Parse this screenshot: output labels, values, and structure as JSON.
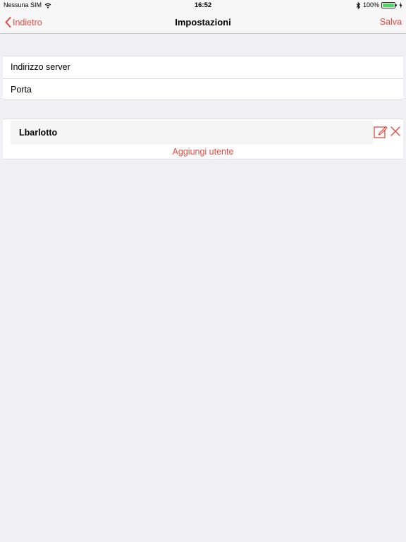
{
  "status_bar": {
    "carrier": "Nessuna SIM",
    "time": "16:52",
    "battery": "100%",
    "battery_level": 1.0,
    "icons": [
      "wifi-icon",
      "bluetooth-icon",
      "battery-icon",
      "charging-icon"
    ]
  },
  "nav": {
    "back_label": "Indietro",
    "title": "Impostazioni",
    "save_label": "Salva"
  },
  "server_settings": {
    "address_placeholder": "Indirizzo server",
    "port_placeholder": "Porta"
  },
  "users": {
    "items": [
      {
        "name": "Lbarlotto",
        "icons": [
          "edit-icon",
          "close-icon"
        ]
      }
    ],
    "add_label": "Aggiungi utente"
  },
  "colors": {
    "accent": "#e8493e",
    "background": "#efeff4",
    "battery": "#4cd964"
  }
}
